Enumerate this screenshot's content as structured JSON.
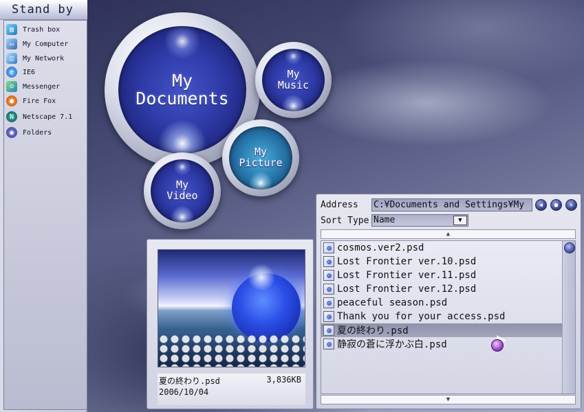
{
  "sidebar": {
    "title": "Stand by",
    "items": [
      {
        "label": "Trash box",
        "icon": "trash-icon"
      },
      {
        "label": "My Computer",
        "icon": "computer-icon"
      },
      {
        "label": "My Network",
        "icon": "network-icon"
      },
      {
        "label": "IE6",
        "icon": "ie-icon"
      },
      {
        "label": "Messenger",
        "icon": "messenger-icon"
      },
      {
        "label": "Fire Fox",
        "icon": "firefox-icon"
      },
      {
        "label": "Netscape 7.1",
        "icon": "netscape-icon"
      },
      {
        "label": "Folders",
        "icon": "folders-icon"
      }
    ]
  },
  "bubbles": {
    "documents": "My\nDocuments",
    "music": "My\nMusic",
    "picture": "My\nPicture",
    "video": "My\nVideo"
  },
  "preview": {
    "filename": "夏の終わり.psd",
    "size": "3,836KB",
    "date": "2006/10/04"
  },
  "browser": {
    "address_label": "Address",
    "address_value": "C:¥Documents and Settings¥My",
    "sort_label": "Sort Type",
    "sort_value": "Name",
    "files": [
      "cosmos.ver2.psd",
      "Lost Frontier ver.10.psd",
      "Lost Frontier ver.11.psd",
      "Lost Frontier ver.12.psd",
      "peaceful season.psd",
      "Thank you for your access.psd",
      "夏の終わり.psd",
      "静寂の蒼に浮かぶ白.psd"
    ],
    "selected_index": 6
  },
  "colors": {
    "accent": "#2e3aa6",
    "panel": "#d4d6e5",
    "selection": "#8e91ab"
  }
}
